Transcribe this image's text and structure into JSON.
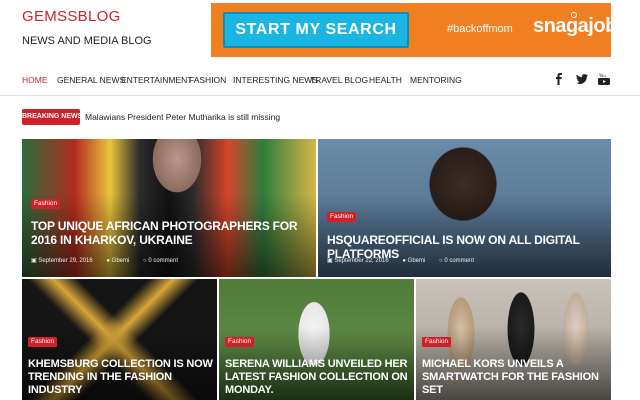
{
  "site": {
    "title": "GEMSSBLOG",
    "tagline": "NEWS AND MEDIA BLOG"
  },
  "ad": {
    "button_label": "START MY SEARCH",
    "hashtag": "#backoffmom",
    "brand": "snagajob",
    "bg_color": "#f07f21",
    "button_color": "#1ab5e3"
  },
  "nav": {
    "items": [
      {
        "label": "HOME",
        "active": true
      },
      {
        "label": "GENERAL NEWS"
      },
      {
        "label": "ENTERTAINMENT"
      },
      {
        "label": "FASHION"
      },
      {
        "label": "INTERESTING NEWS"
      },
      {
        "label": "TRAVEL BLOG"
      },
      {
        "label": "HEALTH"
      },
      {
        "label": "MENTORING"
      }
    ],
    "social": [
      "facebook-icon",
      "twitter-icon",
      "youtube-icon"
    ]
  },
  "breaking": {
    "label": "BREAKING NEWS",
    "text": "Malawians President Peter Mutharika is still missing"
  },
  "posts": [
    {
      "category": "Fashion",
      "title": "TOP UNIQUE AFRICAN PHOTOGRAPHERS FOR 2016 IN KHARKOV, UKRAINE",
      "date": "September 29, 2016",
      "author": "Gbemi",
      "comments": "0 comment"
    },
    {
      "category": "Fashion",
      "title": "HSQUAREOFFICIAL IS NOW ON ALL DIGITAL PLATFORMS",
      "date": "September 22, 2016",
      "author": "Gbemi",
      "comments": "0 comment"
    },
    {
      "category": "Fashion",
      "title": "KHEMSBURG COLLECTION IS NOW TRENDING IN THE FASHION INDUSTRY"
    },
    {
      "category": "Fashion",
      "title": "SERENA WILLIAMS UNVEILED HER LATEST FASHION COLLECTION ON MONDAY."
    },
    {
      "category": "Fashion",
      "title": "MICHAEL KORS UNVEILS A SMARTWATCH FOR THE FASHION SET"
    }
  ],
  "colors": {
    "accent": "#d0202a"
  }
}
